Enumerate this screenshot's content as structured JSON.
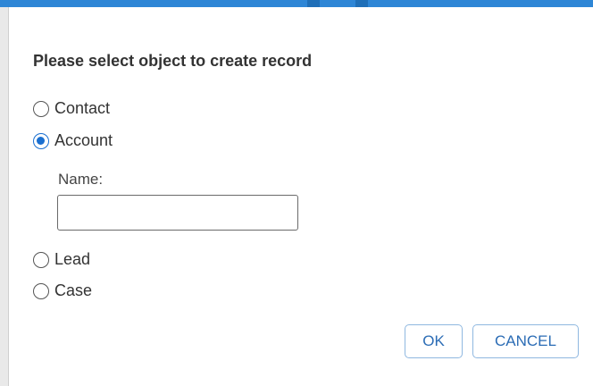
{
  "dialog": {
    "title": "Please select object to create record",
    "options": [
      {
        "label": "Contact",
        "checked": false
      },
      {
        "label": "Account",
        "checked": true
      },
      {
        "label": "Lead",
        "checked": false
      },
      {
        "label": "Case",
        "checked": false
      }
    ],
    "name_label": "Name:",
    "name_value": "",
    "ok_label": "OK",
    "cancel_label": "CANCEL"
  },
  "colors": {
    "accent": "#2e86d6",
    "button_text": "#2b6cb5",
    "button_border": "#8fb8e0"
  }
}
